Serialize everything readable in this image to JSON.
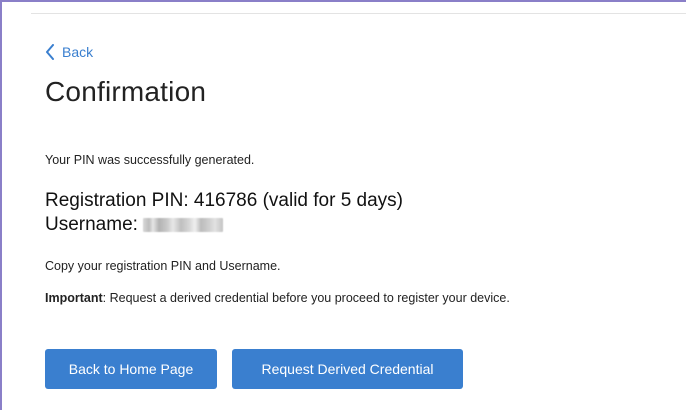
{
  "nav": {
    "back_label": "Back"
  },
  "page": {
    "title": "Confirmation",
    "success_message": "Your PIN was successfully generated.",
    "pin_label": "Registration PIN: 416786 (valid for 5 days)",
    "username_label": "Username:",
    "username_value": "redacted (blurred)",
    "copy_message": "Copy your registration PIN and Username.",
    "important_prefix": "Important",
    "important_message": ": Request a derived credential before you proceed to register your device."
  },
  "actions": {
    "home_label": "Back to Home Page",
    "derived_label": "Request Derived Credential"
  },
  "colors": {
    "accent": "#3a7fcf",
    "frame_border": "#8a7fc8",
    "text": "#222222"
  },
  "icons": {
    "back": "chevron-left-icon"
  }
}
